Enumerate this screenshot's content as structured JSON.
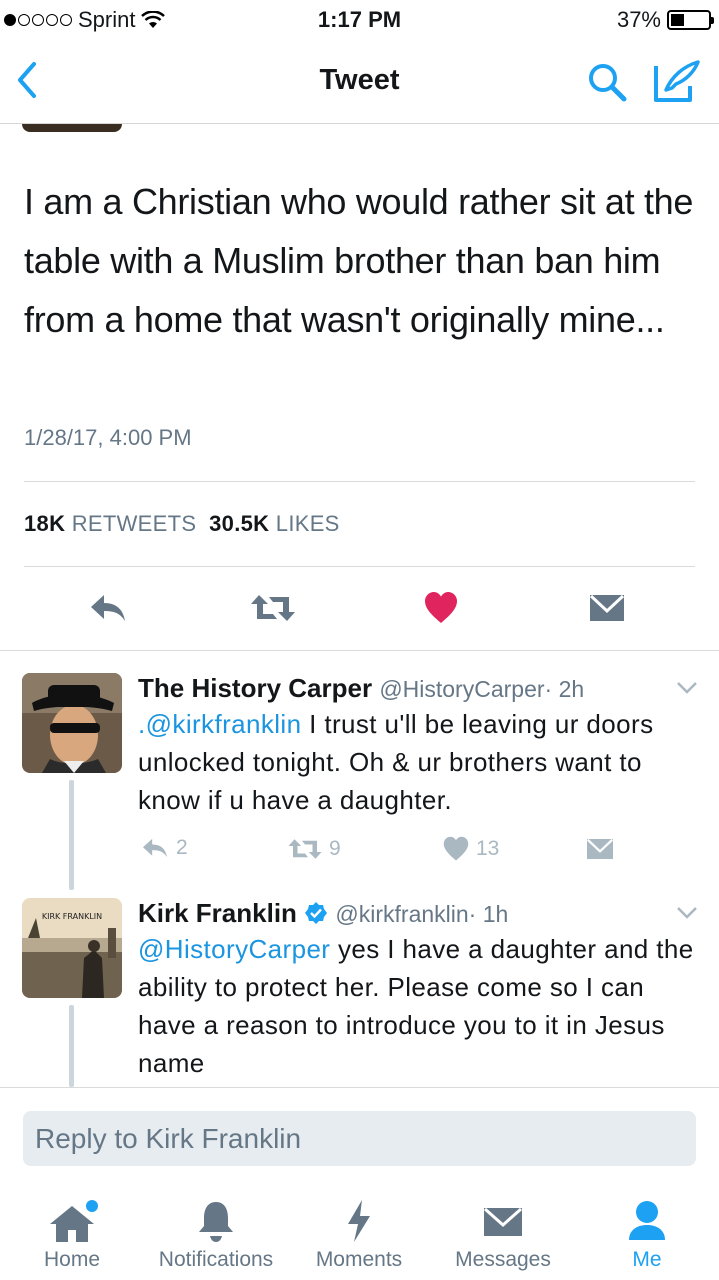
{
  "status_bar": {
    "carrier": "Sprint",
    "time": "1:17 PM",
    "battery": "37%",
    "battery_level": 0.37,
    "signal_bars_filled": 1,
    "signal_bars_total": 5
  },
  "nav": {
    "title": "Tweet",
    "back_icon": "chevron-left-icon",
    "search_icon": "search-icon",
    "compose_icon": "compose-icon",
    "accent_color": "#1da1f2"
  },
  "tweet": {
    "text": "I am a Christian who would rather sit at the table with a Muslim brother than ban him from a home that wasn't originally mine...",
    "date": "1/28/17, 4:00 PM",
    "retweets_count": "18K",
    "retweets_label": "RETWEETS",
    "likes_count": "30.5K",
    "likes_label": "LIKES",
    "liked": true,
    "like_color": "#e0245e"
  },
  "replies": [
    {
      "name": "The History Carper",
      "handle": "@HistoryCarper",
      "time": "· 2h",
      "mention": ".@kirkfranklin",
      "text": " I trust u'll be leaving ur doors unlocked tonight. Oh & ur brothers want to know if u have a daughter.",
      "reply_count": "2",
      "retweet_count": "9",
      "like_count": "13"
    },
    {
      "name": "Kirk Franklin",
      "verified": true,
      "handle": "@kirkfranklin",
      "time": "· 1h",
      "mention": "@HistoryCarper",
      "text": " yes I have a daughter and the ability to protect her. Please come so I can have a reason to introduce you to it in Jesus name",
      "avatar_text": "KIRK FRANKLIN"
    }
  ],
  "reply_box": {
    "placeholder": "Reply to Kirk Franklin"
  },
  "tabbar": [
    {
      "label": "Home",
      "icon": "home-icon",
      "active": false,
      "has_notification_dot": true
    },
    {
      "label": "Notifications",
      "icon": "bell-icon",
      "active": false
    },
    {
      "label": "Moments",
      "icon": "lightning-icon",
      "active": false
    },
    {
      "label": "Messages",
      "icon": "envelope-icon",
      "active": false
    },
    {
      "label": "Me",
      "icon": "person-icon",
      "active": true
    }
  ]
}
